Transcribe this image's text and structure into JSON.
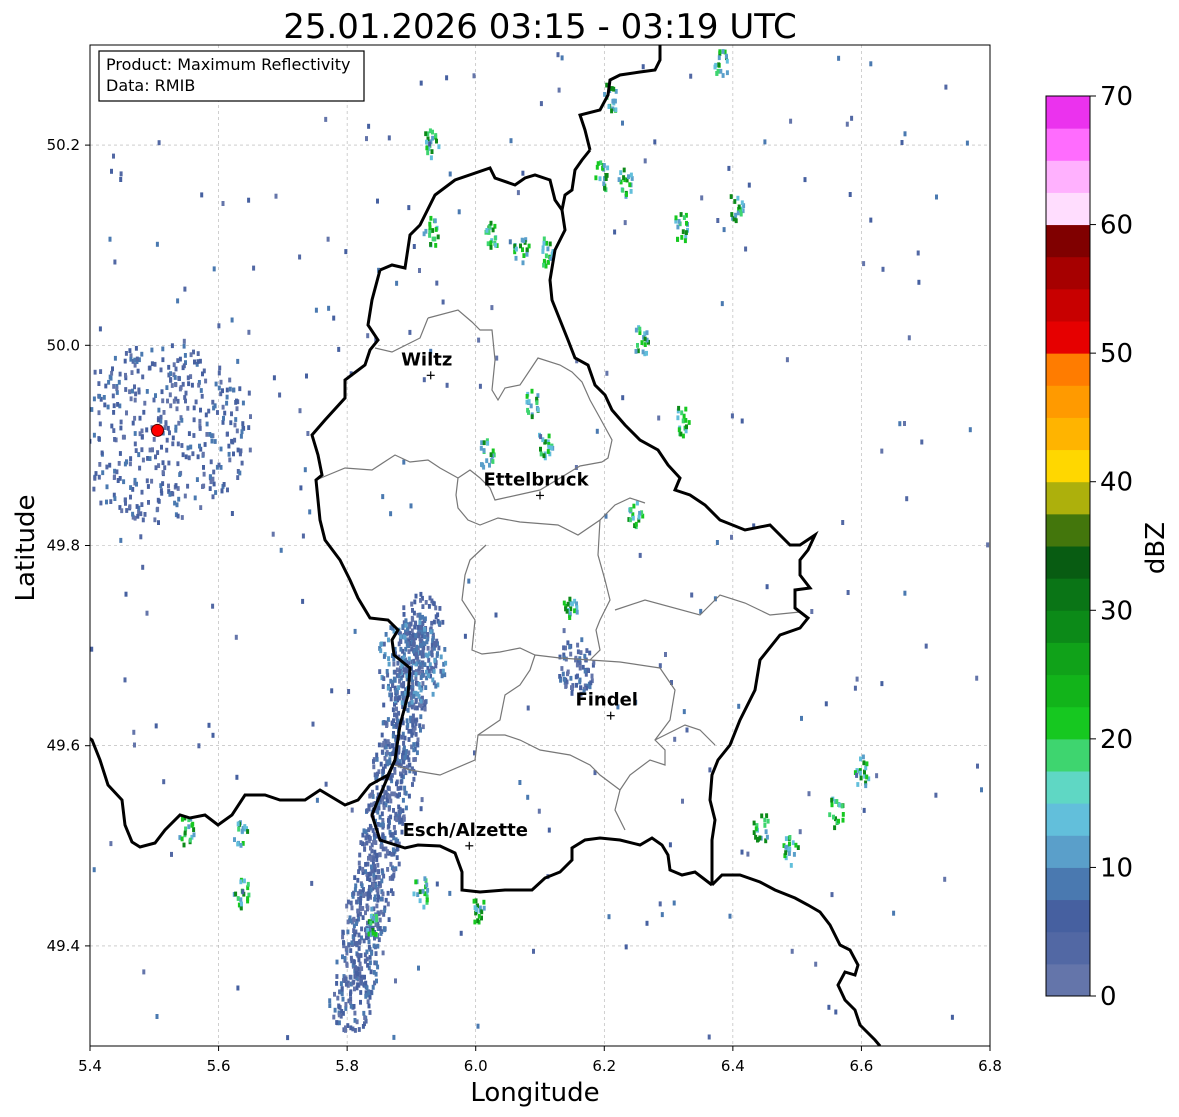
{
  "title": "25.01.2026 03:15 - 03:19 UTC",
  "xlabel": "Longitude",
  "ylabel": "Latitude",
  "info_box": {
    "product": "Product: Maximum Reflectivity",
    "data_source": "Data: RMIB"
  },
  "x_ticks": [
    "5.4",
    "5.6",
    "5.8",
    "6.0",
    "6.2",
    "6.4",
    "6.6",
    "6.8"
  ],
  "y_ticks": [
    "49.4",
    "49.6",
    "49.8",
    "50.0",
    "50.2"
  ],
  "extent": {
    "lon": [
      5.4,
      6.8
    ],
    "lat": [
      49.3,
      50.3
    ]
  },
  "grid": true,
  "colorbar": {
    "label": "dBZ",
    "ticks": [
      "0",
      "10",
      "20",
      "30",
      "40",
      "50",
      "60",
      "70"
    ],
    "range": [
      0,
      70
    ],
    "colors": [
      "#6475aa",
      "#5268a4",
      "#4660a0",
      "#4a79b0",
      "#5a9fca",
      "#62bfdb",
      "#5fd7c4",
      "#3ed56f",
      "#16c820",
      "#12b41a",
      "#10a219",
      "#0c8a18",
      "#0a7516",
      "#085c12",
      "#43760c",
      "#adb00c",
      "#ffd700",
      "#ffb400",
      "#ff9a00",
      "#ff7c00",
      "#e60000",
      "#c80000",
      "#a60000",
      "#800000",
      "#ffddfe",
      "#ffb1fe",
      "#ff6cfe",
      "#eb32ee"
    ]
  },
  "cities": [
    {
      "name": "Wiltz",
      "lon": 5.93,
      "lat": 49.97
    },
    {
      "name": "Ettelbruck",
      "lon": 6.1,
      "lat": 49.85
    },
    {
      "name": "Findel",
      "lon": 6.21,
      "lat": 49.63
    },
    {
      "name": "Esch/Alzette",
      "lon": 5.99,
      "lat": 49.5
    }
  ],
  "radar_site": {
    "lon": 5.505,
    "lat": 49.915,
    "color": "#ff0000"
  }
}
